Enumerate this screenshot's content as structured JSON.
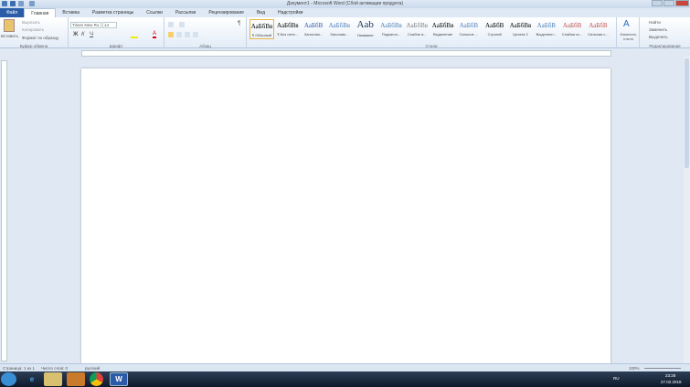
{
  "window": {
    "title": "Документ1 - Microsoft Word (Сбой активации продукта)"
  },
  "tabs": [
    "Файл",
    "Главная",
    "Вставка",
    "Разметка страницы",
    "Ссылки",
    "Рассылки",
    "Рецензирование",
    "Вид",
    "Надстройки"
  ],
  "clipboard": {
    "paste": "Вставить",
    "cut": "Вырезать",
    "copy": "Копировать",
    "format_painter": "Формат по образцу",
    "label": "Буфер обмена"
  },
  "font": {
    "name": "Times New Ro",
    "size": "14",
    "label": "Шрифт"
  },
  "paragraph": {
    "label": "Абзац"
  },
  "styles": {
    "label": "Стили",
    "items": [
      {
        "preview": "АаБбВв",
        "label": "¶ Обычный"
      },
      {
        "preview": "АаБбВв",
        "label": "¶ Без инте..."
      },
      {
        "preview": "АаБбВ",
        "label": "Заголово..."
      },
      {
        "preview": "АаБбВв",
        "label": "Заголово..."
      },
      {
        "preview": "Aab",
        "label": "Название"
      },
      {
        "preview": "АаБбВв",
        "label": "Подзагол..."
      },
      {
        "preview": "АаБбВв",
        "label": "Слабое в..."
      },
      {
        "preview": "АаБбВв",
        "label": "Выделение"
      },
      {
        "preview": "АаБбВ",
        "label": "Сильное ..."
      },
      {
        "preview": "АаБбВ",
        "label": "Строгий"
      },
      {
        "preview": "АаБбВв",
        "label": "Цитата 2"
      },
      {
        "preview": "АаБбВ",
        "label": "Выделенн..."
      },
      {
        "preview": "АаБбВ",
        "label": "Слабая сс..."
      },
      {
        "preview": "АаБбВ",
        "label": "Сильная с..."
      }
    ],
    "change": "Изменить стили"
  },
  "editing": {
    "find": "Найти",
    "replace": "Заменить",
    "select": "Выделить",
    "label": "Редактирование"
  },
  "status": {
    "page": "Страница: 1 из 1",
    "words": "Число слов: 0",
    "lang": "русский",
    "zoom": "100%"
  },
  "taskbar": {
    "lang": "RU",
    "time": "23:28",
    "date": "27.02.2018"
  }
}
